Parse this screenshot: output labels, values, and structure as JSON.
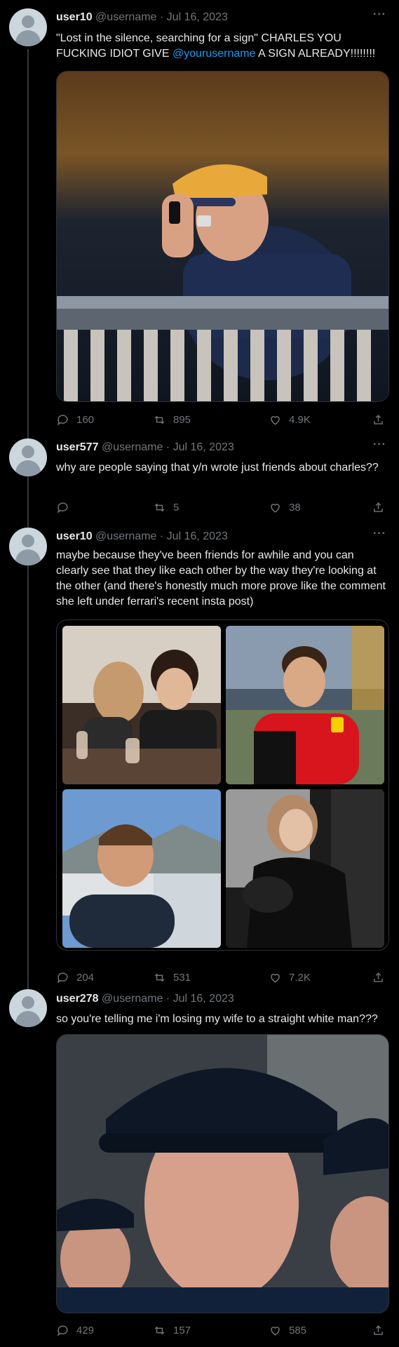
{
  "tweets": [
    {
      "name": "user10",
      "handle": "@username",
      "date": "Jul 16, 2023",
      "text_before": "\"Lost in the silence, searching for a sign\" CHARLES YOU FUCKING IDIOT GIVE ",
      "mention": "@yourusername",
      "text_after": " A SIGN ALREADY!!!!!!!!",
      "replies": "160",
      "retweets": "895",
      "likes": "4.9K"
    },
    {
      "name": "user577",
      "handle": "@username",
      "date": "Jul 16, 2023",
      "text": "why are people saying that y/n wrote just friends about charles??",
      "replies": "",
      "retweets": "5",
      "likes": "38"
    },
    {
      "name": "user10",
      "handle": "@username",
      "date": "Jul 16, 2023",
      "text": "maybe because they've been friends for awhile and you can clearly see that they like each other by the way they're looking at the other (and there's honestly much more prove like the comment she left under ferrari's recent insta post)",
      "replies": "204",
      "retweets": "531",
      "likes": "7.2K"
    },
    {
      "name": "user278",
      "handle": "@username",
      "date": "Jul 16, 2023",
      "text": "so you're telling me i'm losing my wife to a straight white man???",
      "replies": "429",
      "retweets": "157",
      "likes": "585"
    }
  ],
  "separator": "·",
  "more_label": "···",
  "colors": {
    "background": "#000000",
    "text": "#e7e9ea",
    "muted": "#71767b",
    "link": "#1d9bf0"
  },
  "icons": [
    "reply-icon",
    "retweet-icon",
    "like-icon",
    "share-icon",
    "more-icon",
    "avatar-icon"
  ]
}
